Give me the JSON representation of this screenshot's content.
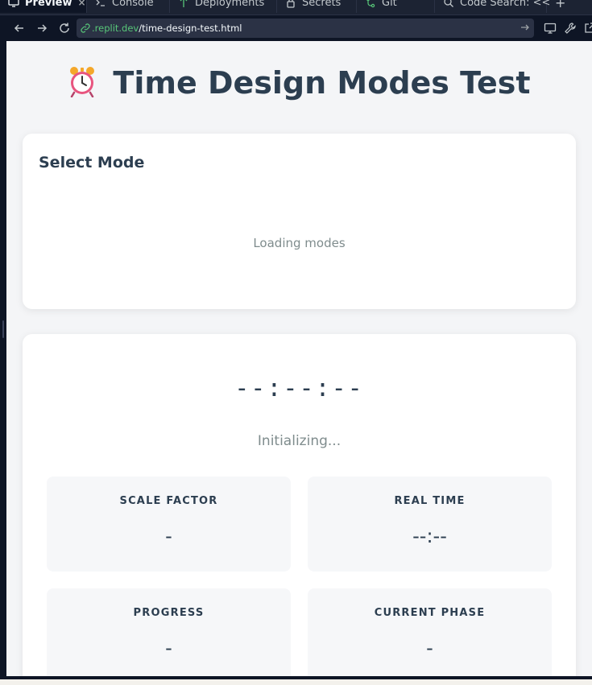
{
  "browser": {
    "tabs": [
      {
        "label": "Preview",
        "icon": "monitor-icon",
        "active": true
      },
      {
        "label": "Console",
        "icon": "terminal-icon"
      },
      {
        "label": "Deployments",
        "icon": "deploy-icon"
      },
      {
        "label": "Secrets",
        "icon": "lock-icon"
      },
      {
        "label": "Git",
        "icon": "git-icon"
      },
      {
        "label": "Code Search: <<",
        "icon": "search-icon"
      }
    ],
    "url_host": ".replit.dev",
    "url_path": "/time-design-test.html"
  },
  "page": {
    "title_icon": "⏰",
    "title": "Time Design Modes Test",
    "mode_card": {
      "heading": "Select Mode",
      "loading_text": "Loading modes"
    },
    "timer": {
      "clock": "--:--:--",
      "status": "Initializing..."
    },
    "stats": [
      {
        "label": "SCALE FACTOR",
        "value": "-"
      },
      {
        "label": "REAL TIME",
        "value": "--:--"
      },
      {
        "label": "PROGRESS",
        "value": "-"
      },
      {
        "label": "CURRENT PHASE",
        "value": "-"
      }
    ]
  },
  "colors": {
    "ide_bg": "#0e1525",
    "ide_panel": "#1c2333",
    "url_host": "#58c779",
    "heading_text": "#2c3e50",
    "muted_text": "#7f8c8d",
    "page_bg": "#f4f5f7"
  }
}
